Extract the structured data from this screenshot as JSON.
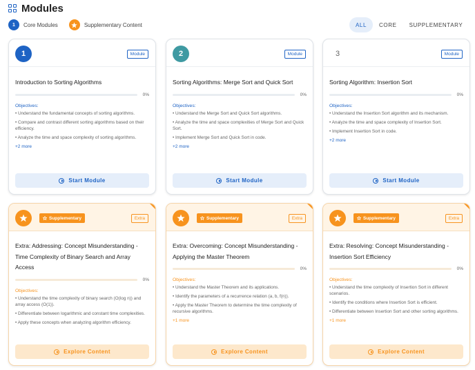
{
  "page": {
    "title": "Modules"
  },
  "legend": {
    "core": {
      "badge": "1",
      "label": "Core Modules"
    },
    "supplementary": {
      "label": "Supplementary Content"
    }
  },
  "filters": [
    "ALL",
    "CORE",
    "SUPPLEMENTARY"
  ],
  "colors": {
    "core": "#1e63c4",
    "supplementary": "#f7931e",
    "teal": "#3f9aa2"
  },
  "core_cards": [
    {
      "number": "1",
      "tag": "Module",
      "title": "Introduction to Sorting Algorithms",
      "progress": "0%",
      "objectives_label": "Objectives:",
      "objectives": [
        "• Understand the fundamental concepts of sorting algorithms.",
        "• Compare and contrast different sorting algorithms based on their efficiency.",
        "• Analyze the time and space complexity of sorting algorithms."
      ],
      "more": "+2 more",
      "button": "Start Module"
    },
    {
      "number": "2",
      "tag": "Module",
      "title": "Sorting Algorithms: Merge Sort and Quick Sort",
      "progress": "0%",
      "objectives_label": "Objectives:",
      "objectives": [
        "• Understand the Merge Sort and Quick Sort algorithms.",
        "• Analyze the time and space complexities of Merge Sort and Quick Sort.",
        "• Implement Merge Sort and Quick Sort in code."
      ],
      "more": "+2 more",
      "button": "Start Module"
    },
    {
      "number": "3",
      "tag": "Module",
      "title": "Sorting Algorithm: Insertion Sort",
      "progress": "0%",
      "objectives_label": "Objectives:",
      "objectives": [
        "• Understand the Insertion Sort algorithm and its mechanism.",
        "• Analyze the time and space complexity of Insertion Sort.",
        "• Implement Insertion Sort in code."
      ],
      "more": "+2 more",
      "button": "Start Module"
    }
  ],
  "supp_cards": [
    {
      "label": "Supplementary",
      "tag": "Extra",
      "title": "Extra: Addressing: Concept Misunderstanding - Time Complexity of Binary Search and Array Access",
      "progress": "0%",
      "objectives_label": "Objectives:",
      "objectives": [
        "• Understand the time complexity of binary search (O(log n)) and array access (O(1)).",
        "• Differentiate between logarithmic and constant time complexities.",
        "• Apply these concepts when analyzing algorithm efficiency."
      ],
      "button": "Explore Content"
    },
    {
      "label": "Supplementary",
      "tag": "Extra",
      "title": "Extra: Overcoming: Concept Misunderstanding - Applying the Master Theorem",
      "progress": "0%",
      "objectives_label": "Objectives:",
      "objectives": [
        "• Understand the Master Theorem and its applications.",
        "• Identify the parameters of a recurrence relation (a, b, f(n)).",
        "• Apply the Master Theorem to determine the time complexity of recursive algorithms."
      ],
      "more": "+1 more",
      "button": "Explore Content"
    },
    {
      "label": "Supplementary",
      "tag": "Extra",
      "title": "Extra: Resolving: Concept Misunderstanding - Insertion Sort Efficiency",
      "progress": "0%",
      "objectives_label": "Objectives:",
      "objectives": [
        "• Understand the time complexity of Insertion Sort in different scenarios.",
        "• Identify the conditions where Insertion Sort is efficient.",
        "• Differentiate between Insertion Sort and other sorting algorithms."
      ],
      "more": "+1 more",
      "button": "Explore Content"
    }
  ]
}
